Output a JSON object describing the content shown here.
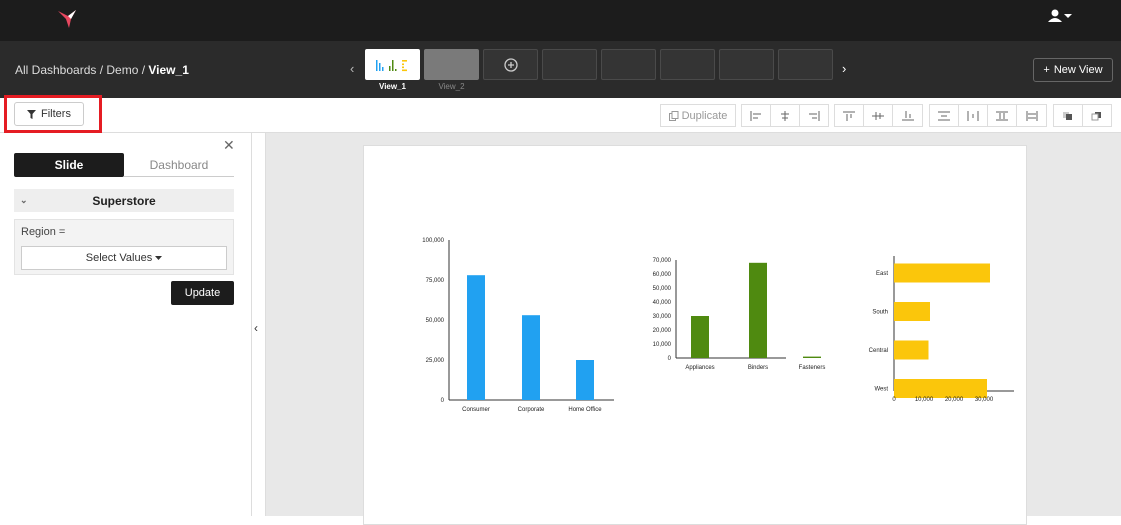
{
  "header": {
    "logo_icon": "hummingbird-logo",
    "user_icon": "user-icon"
  },
  "breadcrumb": {
    "path": "All Dashboards / Demo / ",
    "current": "View_1"
  },
  "views": {
    "tabs": [
      {
        "label": "View_1",
        "state": "active"
      },
      {
        "label": "View_2",
        "state": "inactive"
      }
    ],
    "add_icon": "plus-circle-icon",
    "prev_icon": "chevron-left-icon",
    "next_icon": "chevron-right-icon",
    "new_view_label": "New View"
  },
  "toolbar": {
    "filters_label": "Filters",
    "duplicate_label": "Duplicate",
    "align_tools": [
      "align-left-icon",
      "align-center-icon",
      "align-right-icon",
      "align-top-icon",
      "align-middle-icon",
      "align-bottom-icon",
      "distribute-vertical-icon",
      "distribute-horizontal-icon",
      "space-vertical-icon",
      "space-horizontal-icon",
      "bring-front-icon",
      "send-back-icon"
    ]
  },
  "sidebar": {
    "tabs": [
      "Slide",
      "Dashboard"
    ],
    "section_title": "Superstore",
    "filter_label": "Region =",
    "select_placeholder": "Select Values",
    "update_label": "Update"
  },
  "chart_data": [
    {
      "type": "bar",
      "categories": [
        "Consumer",
        "Corporate",
        "Home Office"
      ],
      "values": [
        78000,
        53000,
        25000
      ],
      "ylim": [
        0,
        100000
      ],
      "yticks": [
        "0",
        "25,000",
        "50,000",
        "75,000",
        "100,000"
      ],
      "color": "#21a1f1"
    },
    {
      "type": "bar",
      "categories": [
        "Appliances",
        "Binders",
        "Fasteners"
      ],
      "values": [
        30000,
        68000,
        1000
      ],
      "ylim": [
        0,
        70000
      ],
      "yticks": [
        "0",
        "10,000",
        "20,000",
        "30,000",
        "40,000",
        "50,000",
        "60,000",
        "70,000"
      ],
      "color": "#4f8a10"
    },
    {
      "type": "bar",
      "orientation": "horizontal",
      "categories": [
        "East",
        "South",
        "Central",
        "West"
      ],
      "values": [
        32000,
        12000,
        11500,
        31000
      ],
      "xlim": [
        0,
        40000
      ],
      "xticks": [
        "0",
        "10,000",
        "20,000",
        "30,000"
      ],
      "color": "#fbc60b"
    }
  ]
}
